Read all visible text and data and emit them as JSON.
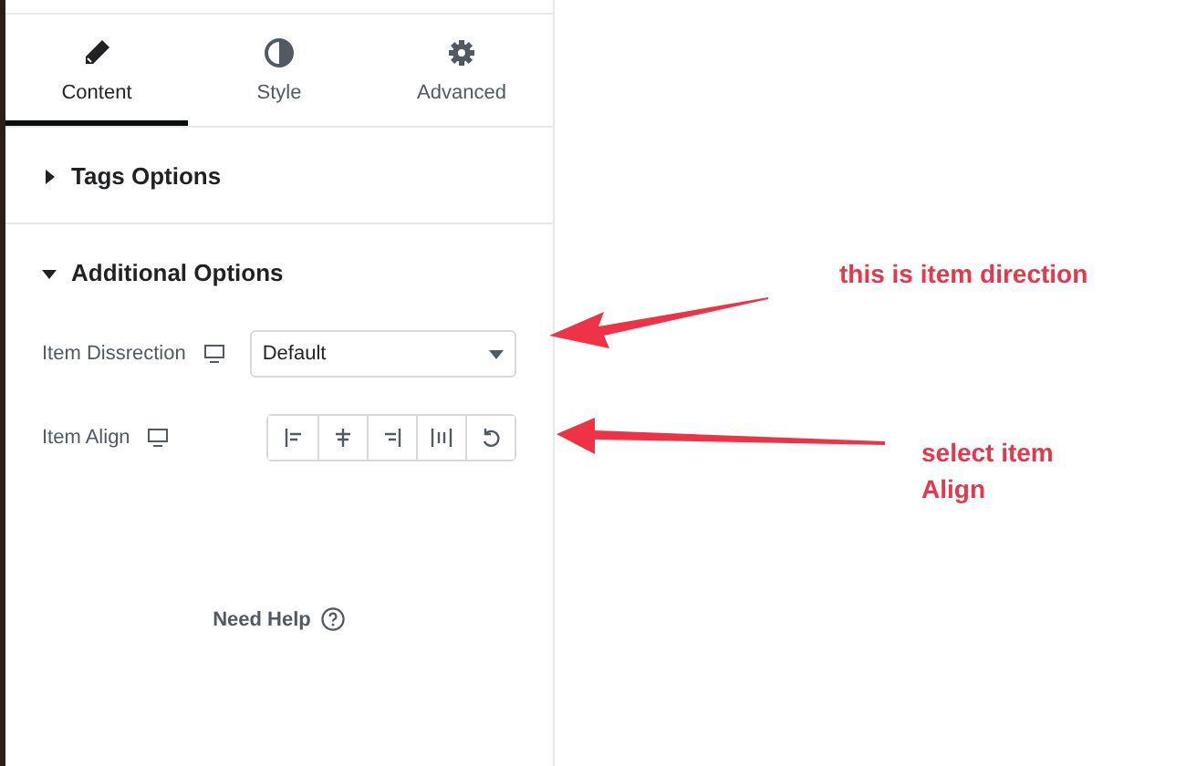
{
  "tabs": [
    {
      "label": "Content",
      "kind": "pencil",
      "selected": true
    },
    {
      "label": "Style",
      "kind": "contrast",
      "selected": false
    },
    {
      "label": "Advanced",
      "kind": "gear",
      "selected": false
    }
  ],
  "sections": [
    {
      "title": "Tags Options",
      "expanded": false
    },
    {
      "title": "Additional Options",
      "expanded": true,
      "controls": [
        {
          "kind": "select",
          "label": "Item Dissrection",
          "value": "Default"
        },
        {
          "kind": "buttons",
          "label": "Item Align",
          "options": [
            {
              "kind": "align-left"
            },
            {
              "kind": "align-center"
            },
            {
              "kind": "align-right"
            },
            {
              "kind": "justify"
            },
            {
              "kind": "reset"
            }
          ]
        }
      ]
    }
  ],
  "help": {
    "label": "Need Help"
  },
  "annotations": [
    {
      "text": "this is item direction"
    },
    {
      "text": "select item Align"
    }
  ]
}
